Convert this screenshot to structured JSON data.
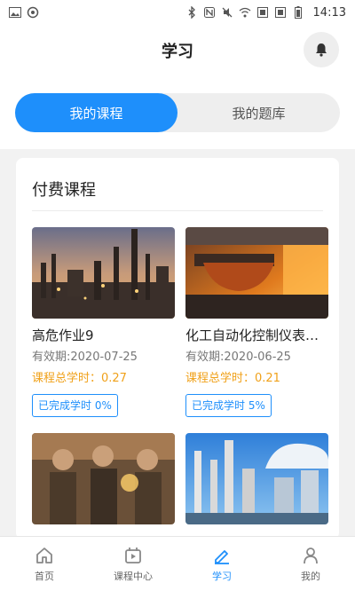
{
  "status_bar": {
    "time": "14:13",
    "left_icons": [
      "image-icon",
      "sync-icon"
    ],
    "right_icons": [
      "bluetooth-icon",
      "nfc-icon",
      "mute-icon",
      "wifi-icon",
      "sim1-icon",
      "sim2-icon",
      "battery-icon"
    ]
  },
  "header": {
    "title": "学习"
  },
  "tabs": [
    {
      "label": "我的课程",
      "active": true
    },
    {
      "label": "我的题库",
      "active": false
    }
  ],
  "section": {
    "title": "付费课程"
  },
  "courses": [
    {
      "name": "高危作业9",
      "validity": "有效期:2020-07-25",
      "hours": "课程总学时：0.27",
      "progress": "已完成学时 0%"
    },
    {
      "name": "化工自动化控制仪表作业",
      "validity": "有效期:2020-06-25",
      "hours": "课程总学时：0.21",
      "progress": "已完成学时 5%"
    },
    {
      "name": "",
      "validity": "",
      "hours": "",
      "progress": ""
    },
    {
      "name": "",
      "validity": "",
      "hours": "",
      "progress": ""
    }
  ],
  "bottom_nav": [
    {
      "label": "首页",
      "icon": "home-icon",
      "active": false
    },
    {
      "label": "课程中心",
      "icon": "course-center-icon",
      "active": false
    },
    {
      "label": "学习",
      "icon": "pencil-icon",
      "active": true
    },
    {
      "label": "我的",
      "icon": "person-icon",
      "active": false
    }
  ],
  "colors": {
    "accent": "#1e8ffb",
    "hours": "#f0a11a"
  }
}
